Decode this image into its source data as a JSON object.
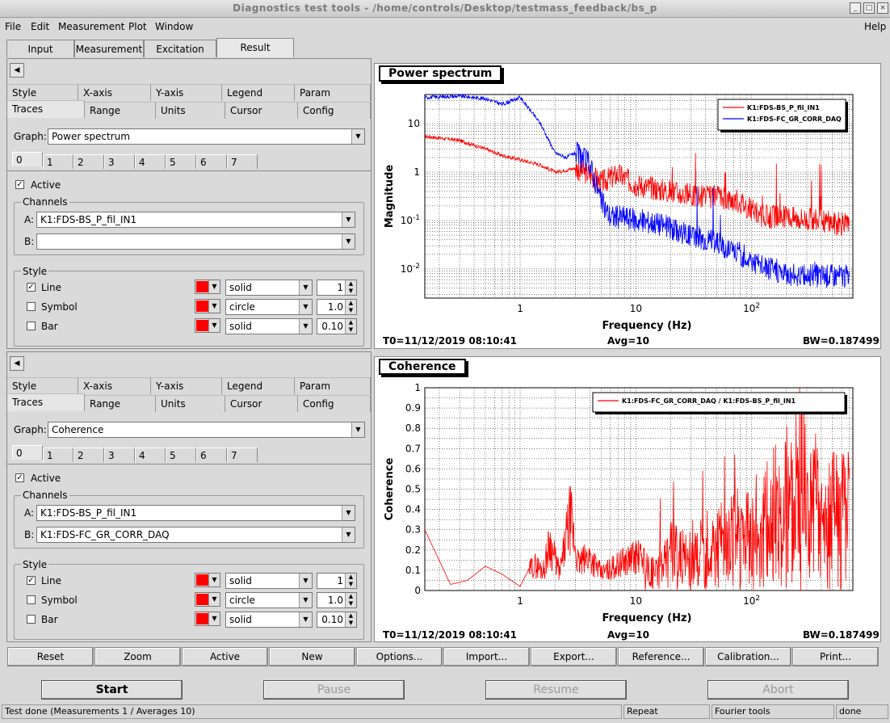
{
  "window": {
    "title": "Diagnostics test tools - /home/controls/Desktop/testmass_feedback/bs_p"
  },
  "menu": {
    "file": "File",
    "edit": "Edit",
    "measurement": "Measurement",
    "plot": "Plot",
    "window": "Window",
    "help": "Help"
  },
  "tabs": [
    "Input",
    "Measurement",
    "Excitation",
    "Result"
  ],
  "panels": [
    {
      "subtabs_row1": [
        "Style",
        "X-axis",
        "Y-axis",
        "Legend",
        "Param"
      ],
      "subtabs_row2": [
        "Traces",
        "Range",
        "Units",
        "Cursor",
        "Config"
      ],
      "graph_label": "Graph:",
      "graph_value": "Power spectrum",
      "trace_tabs": [
        "0",
        "1",
        "2",
        "3",
        "4",
        "5",
        "6",
        "7"
      ],
      "active_label": "Active",
      "channels_label": "Channels",
      "channel_a_label": "A:",
      "channel_a": "K1:FDS-BS_P_fil_IN1",
      "channel_b_label": "B:",
      "channel_b": "",
      "style_label": "Style",
      "line_label": "Line",
      "line_style": "solid",
      "line_width": "1",
      "symbol_label": "Symbol",
      "symbol_style": "circle",
      "symbol_size": "1.0",
      "bar_label": "Bar",
      "bar_style": "solid",
      "bar_width": "0.10"
    },
    {
      "subtabs_row1": [
        "Style",
        "X-axis",
        "Y-axis",
        "Legend",
        "Param"
      ],
      "subtabs_row2": [
        "Traces",
        "Range",
        "Units",
        "Cursor",
        "Config"
      ],
      "graph_label": "Graph:",
      "graph_value": "Coherence",
      "trace_tabs": [
        "0",
        "1",
        "2",
        "3",
        "4",
        "5",
        "6",
        "7"
      ],
      "active_label": "Active",
      "channels_label": "Channels",
      "channel_a_label": "A:",
      "channel_a": "K1:FDS-BS_P_fil_IN1",
      "channel_b_label": "B:",
      "channel_b": "K1:FDS-FC_GR_CORR_DAQ",
      "style_label": "Style",
      "line_label": "Line",
      "line_style": "solid",
      "line_width": "1",
      "symbol_label": "Symbol",
      "symbol_style": "circle",
      "symbol_size": "1.0",
      "bar_label": "Bar",
      "bar_style": "solid",
      "bar_width": "0.10"
    }
  ],
  "plots": [
    {
      "title": "Power spectrum",
      "t0": "T0=11/12/2019 08:10:41",
      "avg": "Avg=10",
      "bw": "BW=0.187499",
      "xlabel": "Frequency (Hz)",
      "ylabel": "Magnitude",
      "legend": [
        "K1:FDS-BS_P_fil_IN1",
        "K1:FDS-FC_GR_CORR_DAQ"
      ]
    },
    {
      "title": "Coherence",
      "t0": "T0=11/12/2019 08:10:41",
      "avg": "Avg=10",
      "bw": "BW=0.187499",
      "xlabel": "Frequency (Hz)",
      "ylabel": "Coherence",
      "legend": [
        "K1:FDS-FC_GR_CORR_DAQ / K1:FDS-BS_P_fil_IN1"
      ]
    }
  ],
  "chart_data": [
    {
      "type": "line",
      "title": "Power spectrum",
      "xlabel": "Frequency (Hz)",
      "ylabel": "Magnitude",
      "xscale": "log",
      "yscale": "log",
      "xlim": [
        0.15,
        750
      ],
      "ylim": [
        0.0025,
        40
      ],
      "x_ticks": [
        "1",
        "10",
        "10^2"
      ],
      "y_ticks": [
        "10^-2",
        "10^-1",
        "1",
        "10"
      ],
      "grid": true,
      "legend_position": "top-right",
      "series": [
        {
          "name": "K1:FDS-BS_P_fil_IN1",
          "color": "#ff0000",
          "x": [
            0.15,
            0.3,
            0.5,
            0.7,
            1.0,
            1.5,
            2.0,
            3.0,
            4.0,
            5.0,
            7.0,
            10,
            15,
            20,
            30,
            50,
            80,
            120,
            200,
            400,
            700
          ],
          "y": [
            5.5,
            4.5,
            3.0,
            2.2,
            1.8,
            1.4,
            1.0,
            1.2,
            0.9,
            0.6,
            0.9,
            0.55,
            0.45,
            0.4,
            0.32,
            0.3,
            0.25,
            0.12,
            0.12,
            0.1,
            0.08
          ]
        },
        {
          "name": "K1:FDS-FC_GR_CORR_DAQ",
          "color": "#0000ff",
          "x": [
            0.15,
            0.3,
            0.5,
            0.7,
            1.0,
            1.5,
            2.0,
            2.5,
            3.0,
            4.0,
            5.0,
            6.0,
            8.0,
            10,
            15,
            20,
            30,
            50,
            80,
            120,
            200,
            400,
            700
          ],
          "y": [
            35,
            37,
            33,
            25,
            35,
            10,
            2.5,
            2.0,
            2.5,
            1.5,
            0.25,
            0.12,
            0.12,
            0.1,
            0.09,
            0.07,
            0.05,
            0.035,
            0.02,
            0.012,
            0.008,
            0.007,
            0.007
          ]
        }
      ]
    },
    {
      "type": "line",
      "title": "Coherence",
      "xlabel": "Frequency (Hz)",
      "ylabel": "Coherence",
      "xscale": "log",
      "xlim": [
        0.15,
        750
      ],
      "ylim": [
        0,
        1
      ],
      "x_ticks": [
        "1",
        "10",
        "10^2"
      ],
      "y_ticks": [
        "0",
        "0.1",
        "0.2",
        "0.3",
        "0.4",
        "0.5",
        "0.6",
        "0.7",
        "0.8",
        "0.9",
        "1"
      ],
      "grid": true,
      "legend_position": "top-right",
      "series": [
        {
          "name": "K1:FDS-FC_GR_CORR_DAQ / K1:FDS-BS_P_fil_IN1",
          "color": "#ff0000",
          "x": [
            0.15,
            0.25,
            0.35,
            0.5,
            0.7,
            1.0,
            1.3,
            1.6,
            1.8,
            2.2,
            2.7,
            3.2,
            4.0,
            5.0,
            7.0,
            10,
            15,
            20,
            30,
            50,
            80,
            120,
            200,
            260,
            400,
            700
          ],
          "y": [
            0.3,
            0.03,
            0.05,
            0.12,
            0.08,
            0.02,
            0.15,
            0.12,
            0.28,
            0.1,
            0.42,
            0.15,
            0.2,
            0.1,
            0.15,
            0.2,
            0.15,
            0.3,
            0.25,
            0.4,
            0.45,
            0.55,
            0.7,
            0.88,
            0.65,
            0.6
          ]
        }
      ]
    }
  ],
  "buttons": [
    "Reset",
    "Zoom",
    "Active",
    "New",
    "Options...",
    "Import...",
    "Export...",
    "Reference...",
    "Calibration...",
    "Print..."
  ],
  "controls": {
    "start": "Start",
    "pause": "Pause",
    "resume": "Resume",
    "abort": "Abort"
  },
  "status": {
    "message": "Test done (Measurements 1 / Averages 10)",
    "repeat": "Repeat",
    "tool": "Fourier tools",
    "state": "done"
  }
}
